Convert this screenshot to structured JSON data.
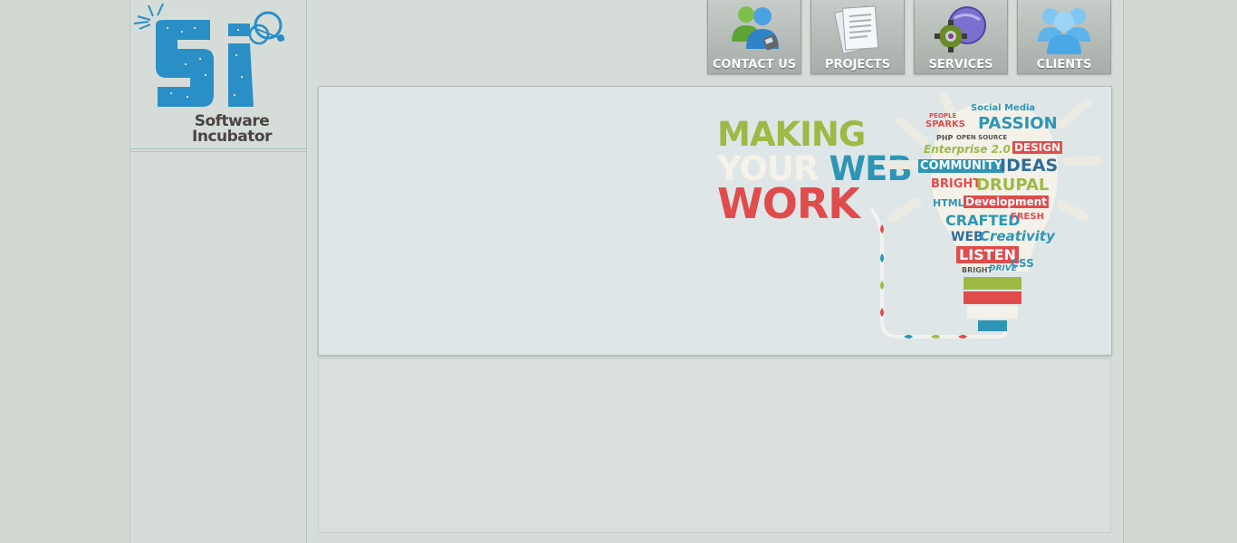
{
  "logo": {
    "line1": "Software",
    "line2": "Incubator",
    "mark": "Si"
  },
  "nav": [
    {
      "label": "CONTACT US",
      "icon": "users-contact-icon"
    },
    {
      "label": "PROJECTS",
      "icon": "documents-icon"
    },
    {
      "label": "SERVICES",
      "icon": "gears-globe-icon"
    },
    {
      "label": "CLIENTS",
      "icon": "group-people-icon"
    }
  ],
  "banner": {
    "slogan_line1": "MAKING",
    "slogan_line2a": "YOUR",
    "slogan_line2b": "WEB",
    "slogan_line3": "WORK",
    "bulb_words": [
      "Social Media",
      "PEOPLE",
      "SPARKS",
      "PASSION",
      "PHP",
      "OPEN SOURCE",
      "Enterprise 2.0",
      "DESIGN",
      "COMMUNITY",
      "IDEAS",
      "BRIGHT",
      "DRUPAL",
      "HTML5",
      "Development",
      "CRAFTED",
      "FRESH",
      "WEB",
      "Creativity",
      "LISTEN",
      "BRIGHT",
      "DRIVE",
      "CSS"
    ]
  },
  "colors": {
    "accent_blue": "#2e95b7",
    "accent_green": "#9eb944",
    "accent_red": "#e04c4c",
    "logo_blue": "#2a8fc6"
  }
}
